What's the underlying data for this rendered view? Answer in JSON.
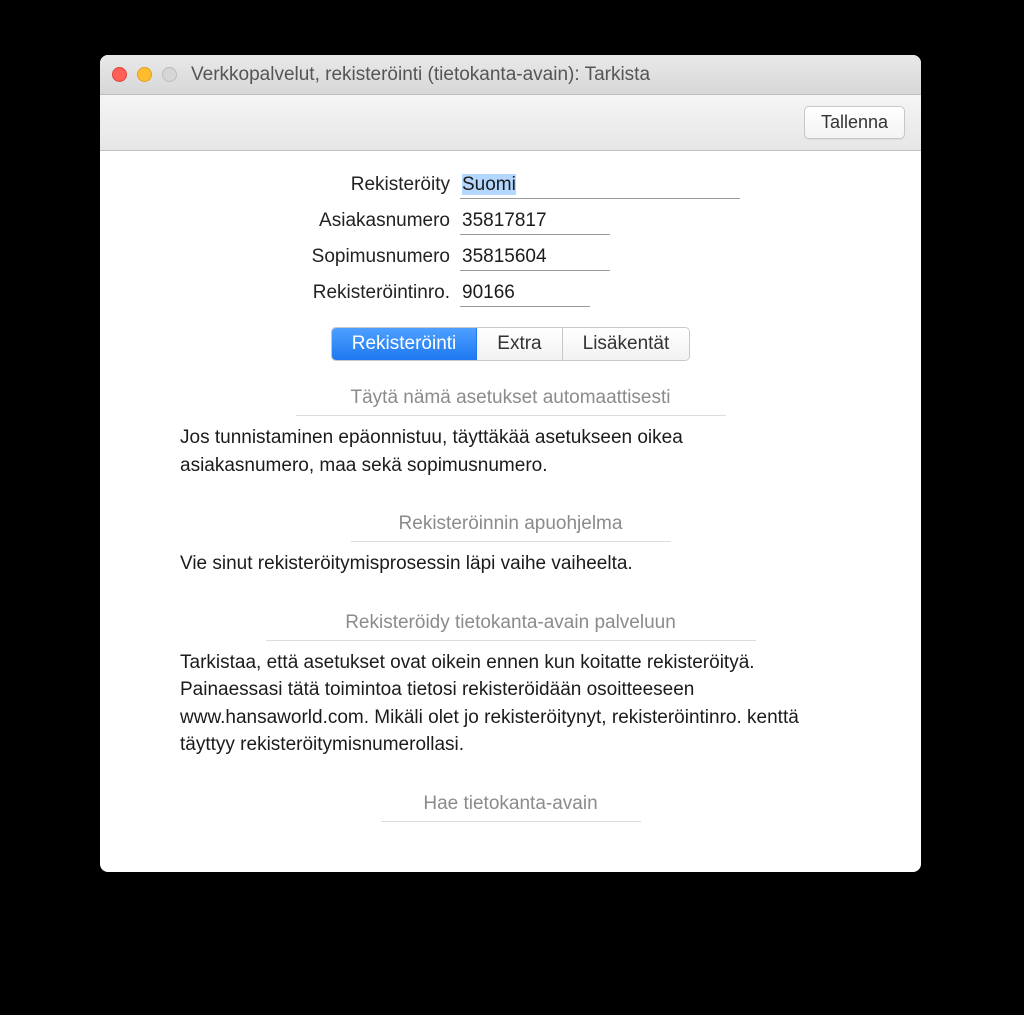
{
  "window": {
    "title": "Verkkopalvelut, rekisteröinti (tietokanta-avain): Tarkista"
  },
  "toolbar": {
    "save_label": "Tallenna"
  },
  "form": {
    "rekisteroity_label": "Rekisteröity",
    "rekisteroity_value": "Suomi",
    "asiakasnumero_label": "Asiakasnumero",
    "asiakasnumero_value": "35817817",
    "sopimusnumero_label": "Sopimusnumero",
    "sopimusnumero_value": "35815604",
    "rekisterointinro_label": "Rekisteröintinro.",
    "rekisterointinro_value": "90166"
  },
  "tabs": {
    "rekisterointi": "Rekisteröinti",
    "extra": "Extra",
    "lisakentat": "Lisäkentät"
  },
  "sections": {
    "auto_fill": {
      "title": "Täytä nämä asetukset automaattisesti",
      "body": "Jos tunnistaminen epäonnistuu, täyttäkää asetukseen oikea asiakasnumero, maa sekä sopimusnumero."
    },
    "wizard": {
      "title": "Rekisteröinnin apuohjelma",
      "body": "Vie sinut rekisteröitymisprosessin läpi vaihe vaiheelta."
    },
    "register_key": {
      "title": "Rekisteröidy tietokanta-avain palveluun",
      "body": "Tarkistaa, että asetukset ovat oikein ennen kun koitatte rekisteröityä. Painaessasi tätä toimintoa tietosi rekisteröidään osoitteeseen www.hansaworld.com. Mikäli olet jo rekisteröitynyt, rekisteröintinro. kenttä täyttyy rekisteröitymisnumerollasi."
    },
    "fetch_key": {
      "title": "Hae tietokanta-avain"
    }
  }
}
